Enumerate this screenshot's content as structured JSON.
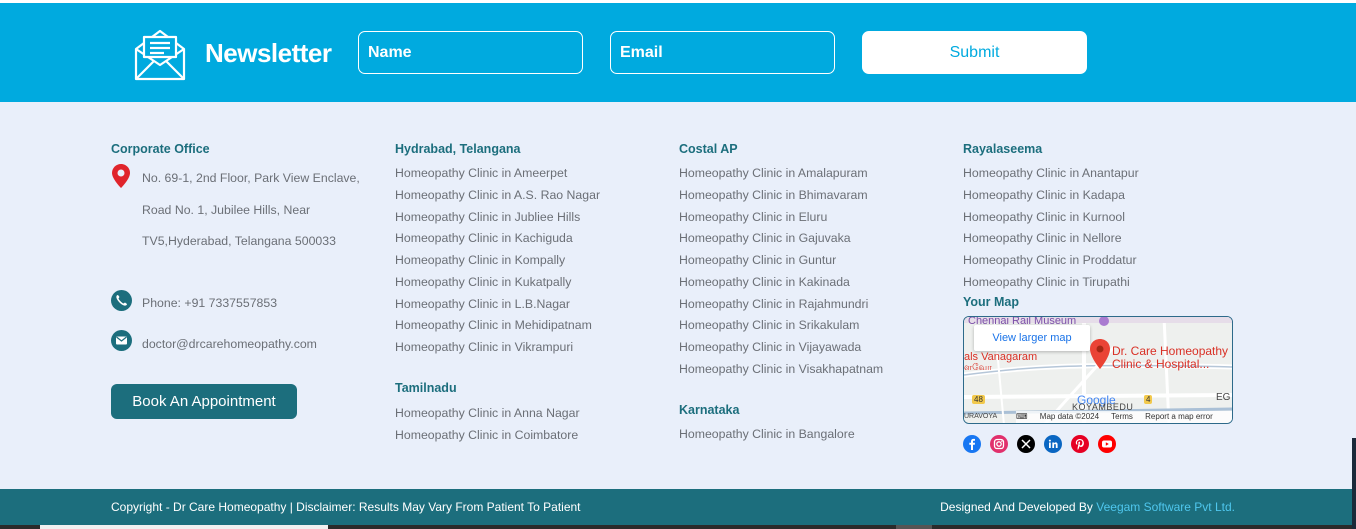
{
  "newsletter": {
    "title": "Newsletter",
    "icon": "envelope-open-icon",
    "name_placeholder": "Name",
    "email_placeholder": "Email",
    "submit_label": "Submit",
    "background": "#00aadf"
  },
  "corporate": {
    "heading": "Corporate Office",
    "address_lines": [
      "No. 69-1, 2nd Floor, Park View Enclave,",
      "Road No. 1, Jubilee Hills, Near",
      "TV5,Hyderabad, Telangana 500033"
    ],
    "phone": "Phone: +91 7337557853",
    "email": "doctor@drcarehomeopathy.com",
    "book_label": "Book An Appointment"
  },
  "hyderabad": {
    "heading": "Hydrabad, Telangana",
    "items": [
      "Homeopathy Clinic in Ameerpet",
      "Homeopathy Clinic in A.S. Rao Nagar",
      "Homeopathy Clinic in Jubliee Hills",
      "Homeopathy Clinic in Kachiguda",
      "Homeopathy Clinic in Kompally",
      "Homeopathy Clinic in Kukatpally",
      "Homeopathy Clinic in L.B.Nagar",
      "Homeopathy Clinic in Mehidipatnam",
      "Homeopathy Clinic in Vikrampuri"
    ]
  },
  "tamilnadu": {
    "heading": "Tamilnadu",
    "items": [
      "Homeopathy Clinic in Anna Nagar",
      "Homeopathy Clinic in Coimbatore"
    ]
  },
  "costal": {
    "heading": "Costal AP",
    "items": [
      "Homeopathy Clinic in Amalapuram",
      "Homeopathy Clinic in Bhimavaram",
      "Homeopathy Clinic in Eluru",
      "Homeopathy Clinic in Gajuvaka",
      "Homeopathy Clinic in Guntur",
      "Homeopathy Clinic in Kakinada",
      "Homeopathy Clinic in Rajahmundri",
      "Homeopathy Clinic in Srikakulam",
      "Homeopathy Clinic in Vijayawada",
      "Homeopathy Clinic in Visakhapatnam"
    ]
  },
  "karnataka": {
    "heading": "Karnataka",
    "items": [
      "Homeopathy Clinic in Bangalore"
    ]
  },
  "rayalaseema": {
    "heading": "Rayalaseema",
    "items": [
      "Homeopathy Clinic in Anantapur",
      "Homeopathy Clinic in Kadapa",
      "Homeopathy Clinic in Kurnool",
      "Homeopathy Clinic in Nellore",
      "Homeopathy Clinic in Proddatur",
      "Homeopathy Clinic in Tirupathi"
    ]
  },
  "map": {
    "heading": "Your Map",
    "view_larger": "View larger map",
    "place_name_1": "Dr. Care Homeopathy",
    "place_name_2": "Clinic & Hospital...",
    "top_label": "Chennai Rail Museum",
    "left_label": "als Vanagaram",
    "left_label_2": "ளவோ",
    "area_label": "KOYAMBEDU",
    "area_label_2": "URAVOYA",
    "corner_label": "EG",
    "road_1": "48",
    "road_2": "4",
    "google": "Google",
    "map_data": "Map data ©2024",
    "terms": "Terms",
    "report": "Report a map error"
  },
  "social": [
    {
      "name": "facebook",
      "color": "#1877f2"
    },
    {
      "name": "instagram",
      "color": "#e1306c"
    },
    {
      "name": "x",
      "color": "#000000"
    },
    {
      "name": "linkedin",
      "color": "#0a66c2"
    },
    {
      "name": "pinterest",
      "color": "#e60023"
    },
    {
      "name": "youtube",
      "color": "#ff0000"
    }
  ],
  "copyright": {
    "left": "Copyright - Dr Care Homeopathy | Disclaimer: Results May Vary From Patient To Patient",
    "right_prefix": "Designed And Developed By ",
    "right_link": "Veegam Software Pvt Ltd.",
    "bar_color": "#1c6e7d"
  }
}
